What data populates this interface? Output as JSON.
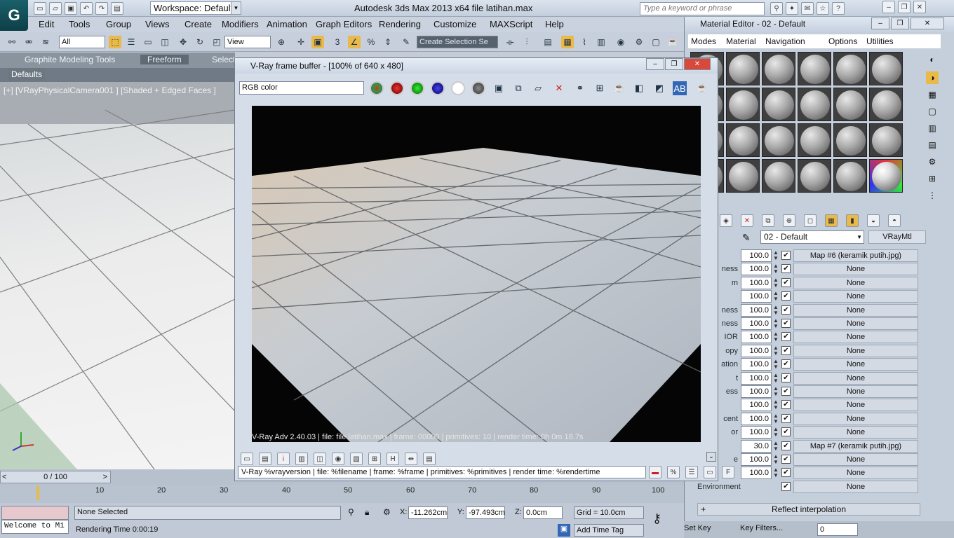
{
  "titlebar": {
    "workspace": "Workspace: Default",
    "app_title": "Autodesk 3ds Max  2013 x64      file latihan.max",
    "search_placeholder": "Type a keyword or phrase"
  },
  "menubar": [
    "Edit",
    "Tools",
    "Group",
    "Views",
    "Create",
    "Modifiers",
    "Animation",
    "Graph Editors",
    "Rendering",
    "Customize",
    "MAXScript",
    "Help"
  ],
  "toolbar": {
    "filter": "All",
    "coord": "View",
    "selection_set": "Create Selection Se"
  },
  "ribbon": {
    "tabs": [
      "Graphite Modeling Tools",
      "Freeform",
      "Selecti"
    ],
    "defaults": "Defaults"
  },
  "viewport": {
    "label": "[+] [VRayPhysicalCamera001 ] [Shaded + Edged Faces ]"
  },
  "vray": {
    "title": "V-Ray frame buffer - [100% of 640 x 480]",
    "channel": "RGB color",
    "status": "V-Ray Adv 2.40.03 | file: file latihan.max | frame: 00000 | primitives: 10 | render time:  0h  0m 18.7s",
    "stamp": "V-Ray %vrayversion | file: %filename | frame: %frame | primitives: %primitives | render time: %rendertime"
  },
  "mated": {
    "title": "Material Editor - 02 - Default",
    "menu": [
      "Modes",
      "Material",
      "Navigation",
      "Options",
      "Utilities"
    ],
    "material_name": "02 - Default",
    "material_type": "VRayMtl",
    "params": [
      {
        "label": "",
        "value": "100.0",
        "map": "Map #6 (keramik putih.jpg)"
      },
      {
        "label": "ness",
        "value": "100.0",
        "map": "None"
      },
      {
        "label": "m",
        "value": "100.0",
        "map": "None"
      },
      {
        "label": "",
        "value": "100.0",
        "map": "None"
      },
      {
        "label": "ness",
        "value": "100.0",
        "map": "None"
      },
      {
        "label": "ness",
        "value": "100.0",
        "map": "None"
      },
      {
        "label": "IOR",
        "value": "100.0",
        "map": "None"
      },
      {
        "label": "opy",
        "value": "100.0",
        "map": "None"
      },
      {
        "label": "ation",
        "value": "100.0",
        "map": "None"
      },
      {
        "label": "t",
        "value": "100.0",
        "map": "None"
      },
      {
        "label": "ess",
        "value": "100.0",
        "map": "None"
      },
      {
        "label": "",
        "value": "100.0",
        "map": "None"
      },
      {
        "label": "cent",
        "value": "100.0",
        "map": "None"
      },
      {
        "label": "or",
        "value": "100.0",
        "map": "None"
      },
      {
        "label": "",
        "value": "30.0",
        "map": "Map #7 (keramik putih.jpg)"
      },
      {
        "label": "e",
        "value": "100.0",
        "map": "None"
      },
      {
        "label": "",
        "value": "100.0",
        "map": "None"
      },
      {
        "label": "Environment",
        "value": "",
        "map": "None"
      }
    ],
    "reflect_interp": "Reflect interpolation"
  },
  "timeline": {
    "frame": "0 / 100",
    "ticks": [
      "10",
      "20",
      "30",
      "40",
      "50",
      "60",
      "70",
      "80",
      "90",
      "100"
    ]
  },
  "status": {
    "selection": "None Selected",
    "rendering_time": "Rendering Time  0:00:19",
    "welcome": "Welcome to Mi",
    "x": "-11.262cm",
    "y": "-97.493cm",
    "z": "0.0cm",
    "grid": "Grid = 10.0cm",
    "add_time_tag": "Add Time Tag",
    "set_key": "Set Key",
    "key_filters": "Key Filters...",
    "key_value": "0"
  },
  "colors": {
    "accent": "#1a5f6a",
    "viewport_bg": "#a8adb3",
    "render_bg": "#050505"
  }
}
